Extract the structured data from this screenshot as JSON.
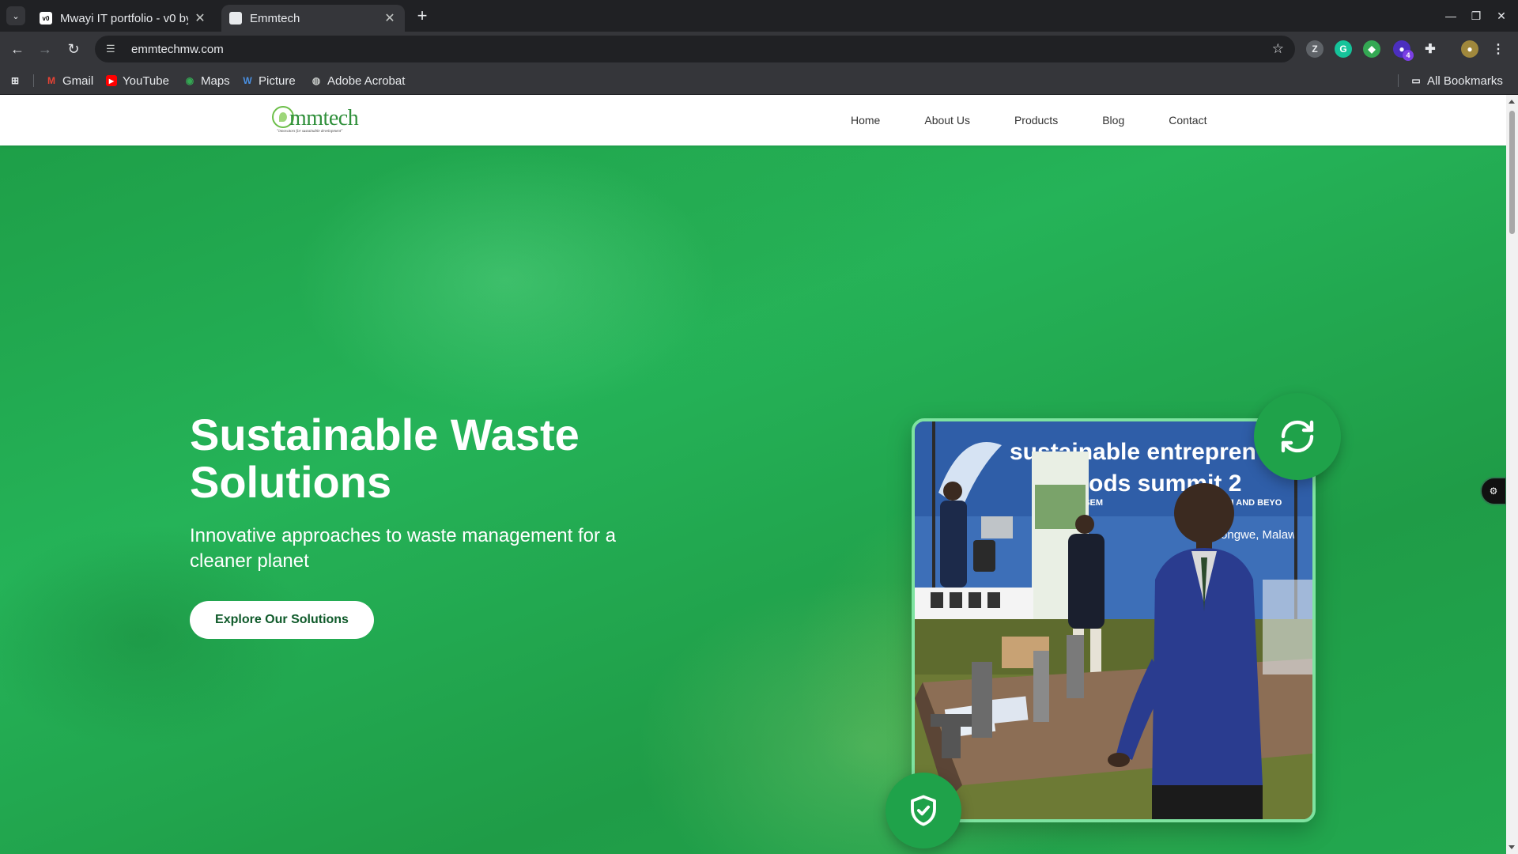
{
  "browser": {
    "tabs": [
      {
        "title": "Mwayi IT portfolio - v0 by",
        "favicon": "v0-icon",
        "favicon_text": "v0",
        "active": false
      },
      {
        "title": "Emmtech",
        "favicon": "page-icon",
        "active": true
      }
    ],
    "new_tab": "+",
    "url": "emmtechmw.com",
    "bookmarks": [
      {
        "label": "Gmail",
        "icon": "gmail-icon",
        "color": "#ea4335"
      },
      {
        "label": "YouTube",
        "icon": "youtube-icon",
        "color": "#ff0000"
      },
      {
        "label": "Maps",
        "icon": "maps-icon",
        "color": "#34a853"
      },
      {
        "label": "Picture",
        "icon": "picture-icon",
        "color": "#4a90e2"
      },
      {
        "label": "Adobe Acrobat",
        "icon": "globe-icon",
        "color": "#c4c7c5"
      }
    ],
    "all_bookmarks": "All Bookmarks",
    "extension_badge_count": "4"
  },
  "site": {
    "logo_text": "mmtech",
    "logo_tagline": "\"innovators for sustainable development\"",
    "nav": [
      "Home",
      "About Us",
      "Products",
      "Blog",
      "Contact"
    ],
    "hero": {
      "title": "Sustainable Waste Solutions",
      "subtitle": "Innovative approaches to waste management for a cleaner planet",
      "cta": "Explore Our Solutions",
      "image": {
        "banner_line1": "sustainable entrepren",
        "banner_line2": "elihoods summit 2",
        "banner_line3": "THE MSEM",
        "banner_line4": "N MALAWI AND BEYO",
        "banner_line5": "Lilongwe, Malaw"
      }
    },
    "colors": {
      "primary_green": "#1fa24a",
      "frame_border": "#7ee3a0",
      "cta_text": "#0f5a2a"
    }
  }
}
